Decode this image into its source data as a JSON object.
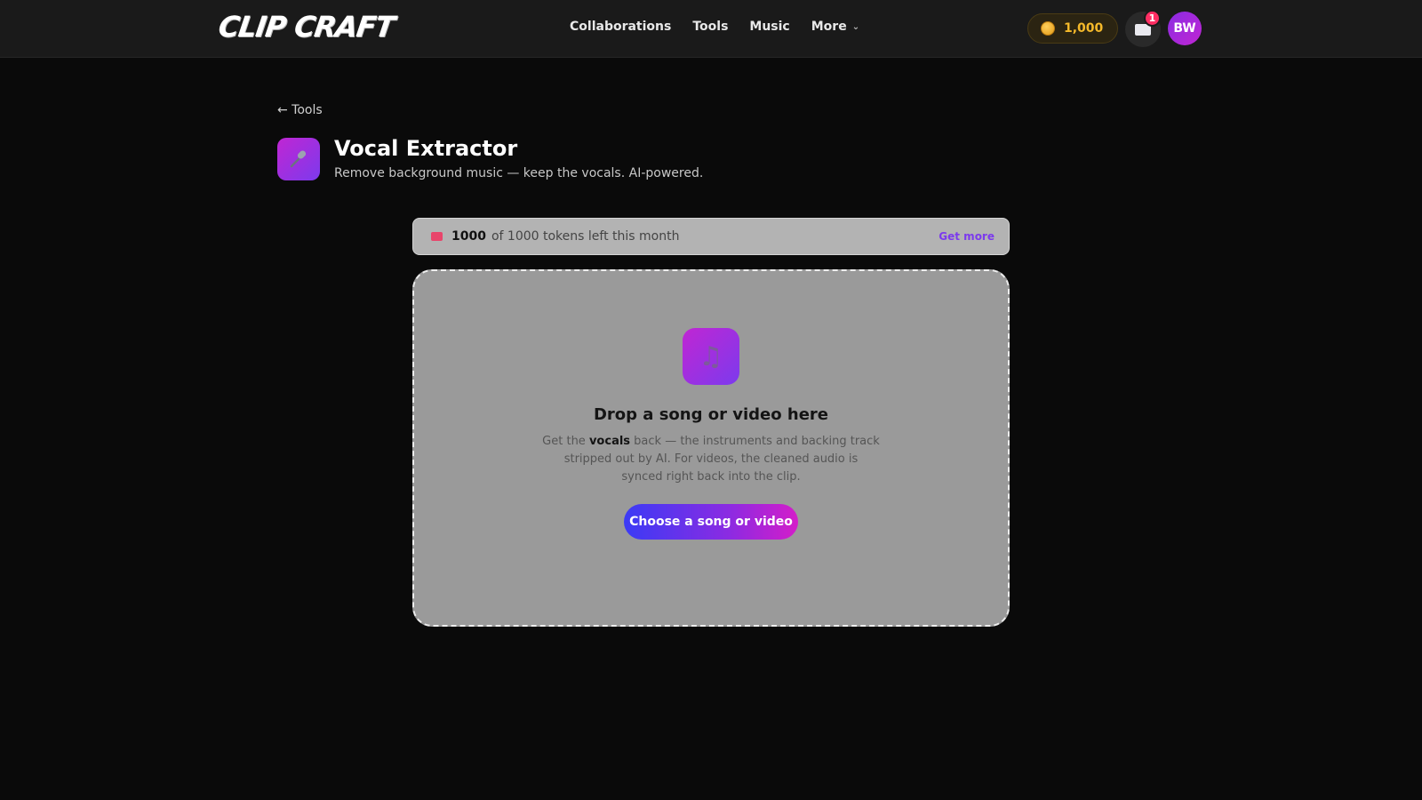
{
  "header": {
    "logo": "CLIP CRAFT",
    "nav": [
      {
        "label": "Collaborations"
      },
      {
        "label": "Tools"
      },
      {
        "label": "Music"
      },
      {
        "label": "More"
      }
    ],
    "coins": "1,000",
    "inbox_badge": "1",
    "avatar_initials": "BW",
    "colors": {
      "accent": "#7c3aed",
      "coin": "#f5b92a",
      "badge": "#ff2e63"
    }
  },
  "page": {
    "back_label": "← Tools",
    "title": "Vocal Extractor",
    "subtitle": "Remove background music — keep the vocals. AI-powered.",
    "tool_icon": "microphone-icon"
  },
  "tokens": {
    "remaining": "1000",
    "text": "of 1000 tokens left this month",
    "get_more": "Get more"
  },
  "dropzone": {
    "icon": "music-note-icon",
    "title": "Drop a song or video here",
    "desc_prefix": "Get the ",
    "desc_bold": "vocals",
    "desc_suffix": " back — the instruments and backing track stripped out by AI. For videos, the cleaned audio is synced right back into the clip.",
    "button": "Choose a song or video"
  }
}
